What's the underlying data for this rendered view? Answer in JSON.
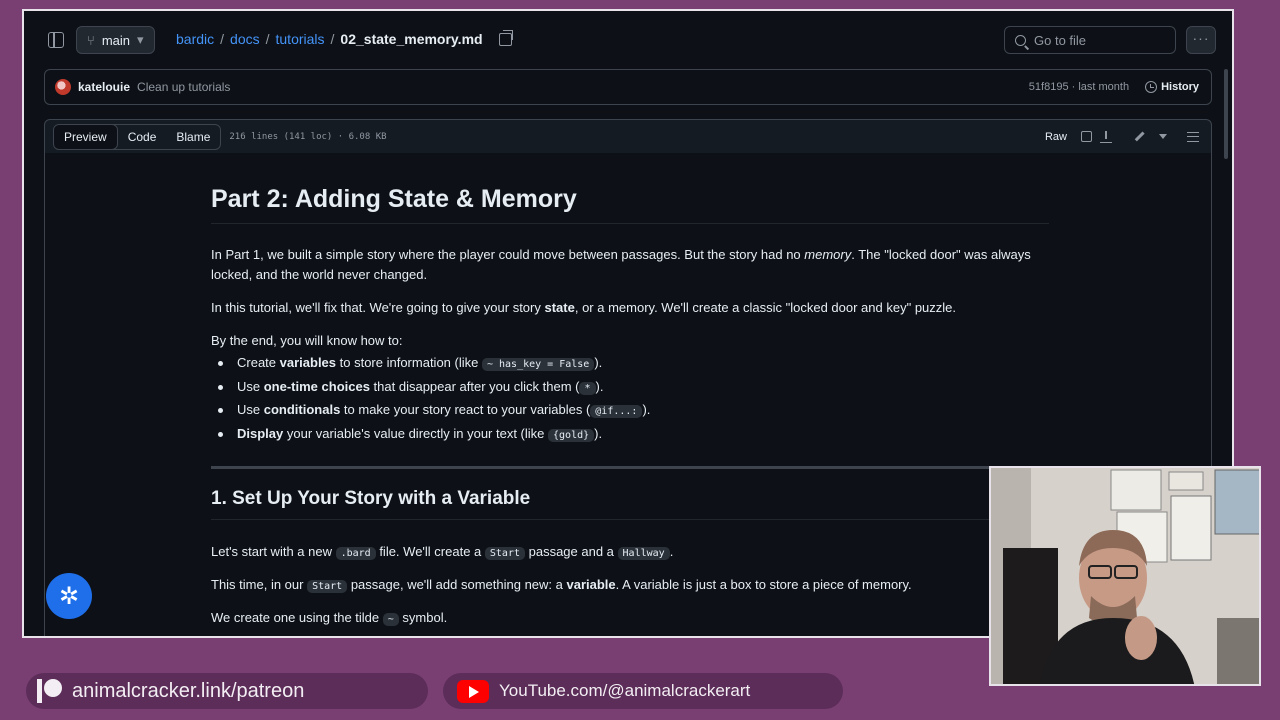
{
  "header": {
    "branch": "main",
    "breadcrumb": [
      "bardic",
      "docs",
      "tutorials"
    ],
    "file_name": "02_state_memory.md",
    "search_placeholder": "Go to file"
  },
  "commit": {
    "author": "katelouie",
    "message": "Clean up tutorials",
    "meta": "51f8195 · last month",
    "history_label": "History"
  },
  "file_header": {
    "tabs": [
      "Preview",
      "Code",
      "Blame"
    ],
    "active_tab": "Preview",
    "info": "216 lines (141 loc) · 6.08 KB",
    "raw_label": "Raw"
  },
  "doc": {
    "title": "Part 2: Adding State & Memory",
    "p1a": "In Part 1, we built a simple story where the player could move between passages. But the story had no ",
    "p1_em": "memory",
    "p1b": ". The \"locked door\" was always locked, and the world never changed.",
    "p2a": "In this tutorial, we'll fix that. We're going to give your story ",
    "p2_b": "state",
    "p2b": ", or a memory. We'll create a classic \"locked door and key\" puzzle.",
    "p3": "By the end, you will know how to:",
    "list": [
      {
        "pre": "Create ",
        "bold": "variables",
        "mid": " to store information (like ",
        "code": "~ has_key = False",
        "post": ")."
      },
      {
        "pre": "Use ",
        "bold": "one-time choices",
        "mid": " that disappear after you click them (",
        "code": "*",
        "post": ")."
      },
      {
        "pre": "Use ",
        "bold": "conditionals",
        "mid": " to make your story react to your variables (",
        "code": "@if...:",
        "post": ")."
      },
      {
        "pre": "",
        "bold": "Display",
        "mid": " your variable's value directly in your text (like ",
        "code": "{gold}",
        "post": ")."
      }
    ],
    "h2": "1. Set Up Your Story with a Variable",
    "p4a": "Let's start with a new ",
    "p4_code1": ".bard",
    "p4b": " file. We'll create a ",
    "p4_code2": "Start",
    "p4c": " passage and a ",
    "p4_code3": "Hallway",
    "p4d": ".",
    "p5a": "This time, in our ",
    "p5_code": "Start",
    "p5b": " passage, we'll add something new: a ",
    "p5_b": "variable",
    "p5c": ". A variable is just a box to store a piece of memory.",
    "p6a": "We create one using the tilde ",
    "p6_code": "~",
    "p6b": " symbol."
  },
  "overlay": {
    "patreon": "animalcracker.link/patreon",
    "youtube": "YouTube.com/@animalcrackerart"
  },
  "icons": {
    "fab": "gear-icon",
    "accent": "#4493f8",
    "fab_color": "#1f6feb",
    "bg_purple": "#7a3f72"
  }
}
